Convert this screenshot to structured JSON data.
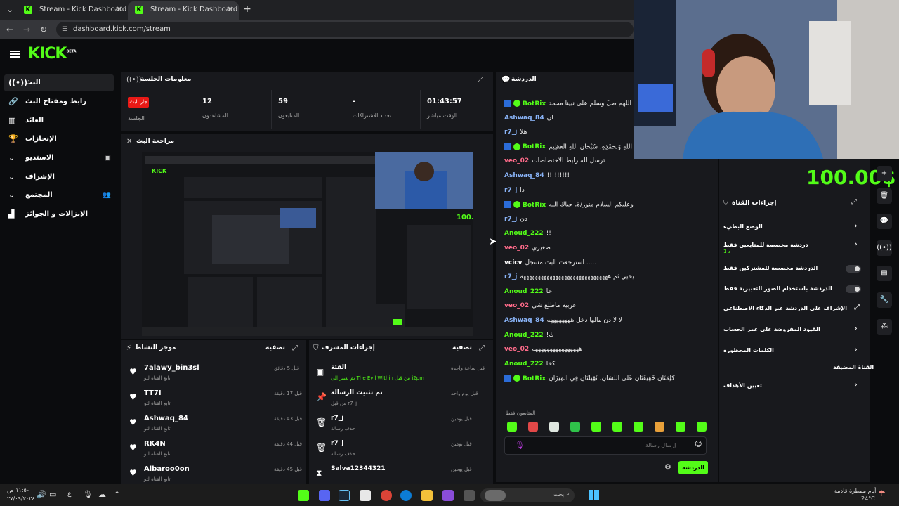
{
  "browser": {
    "tabs": [
      {
        "title": "Stream - Kick Dashboard"
      },
      {
        "title": "Stream - Kick Dashboard"
      }
    ],
    "url": "dashboard.kick.com/stream"
  },
  "app": {
    "logo": "KICK",
    "logo_sup": "BETA"
  },
  "sidebar": {
    "items": [
      {
        "label": "البث",
        "icon": "live-icon"
      },
      {
        "label": "رابط ومفتاح البث",
        "icon": "link-icon"
      },
      {
        "label": "العائد",
        "icon": "library-icon"
      },
      {
        "label": "الإنجازات",
        "icon": "trophy-icon"
      },
      {
        "label": "الاستديو",
        "icon": "chevron-down-icon"
      },
      {
        "label": "الإشراف",
        "icon": "chevron-down-icon"
      },
      {
        "label": "المجتمع",
        "icon": "chevron-down-icon"
      },
      {
        "label": "الإنزالات و الجوائز",
        "icon": "gift-icon"
      }
    ]
  },
  "session": {
    "title": "معلومات الجلسة",
    "live_badge": "جار البث",
    "session_label": "الجلسة",
    "stats": [
      {
        "value": "12",
        "label": "المشاهدون"
      },
      {
        "value": "59",
        "label": "المتابعون"
      },
      {
        "value": "-",
        "label": "تعداد الاشتراكات"
      },
      {
        "value": "01:43:57",
        "label": "الوقت مباشر"
      }
    ]
  },
  "preview": {
    "title": "مراجعة البث"
  },
  "activity_left": {
    "title": "موجز النشاط",
    "filter": "تصفية",
    "items": [
      {
        "name": "7alawy_bin3sl",
        "sub": "تابع القناة لتو",
        "time": "قبل 5 دقائق"
      },
      {
        "name": "TT7I",
        "sub": "تابع القناة لتو",
        "time": "قبل 17 دقيقة"
      },
      {
        "name": "Ashwaq_84",
        "sub": "تابع القناة لتو",
        "time": "قبل 43 دقيقة"
      },
      {
        "name": "RK4N",
        "sub": "تابع القناة لتو",
        "time": "قبل 44 دقيقة"
      },
      {
        "name": "Albaroo0on",
        "sub": "تابع القناة لتو",
        "time": "قبل 45 دقيقة"
      }
    ]
  },
  "activity_mid": {
    "title": "إجراءات المشرف",
    "filter": "تصفية",
    "items": [
      {
        "name": "الفئة",
        "sub": "تم تغيير الى The Evil Within من قبل i2pm",
        "time": "قبل ساعة واحدة"
      },
      {
        "name": "تم تثبيت الرسالة",
        "sub": "من قبل r7_j",
        "time": "قبل يوم واحد"
      },
      {
        "name": "r7_j",
        "sub": "حذف رسالة",
        "time": "قبل يومين"
      },
      {
        "name": "r7_j",
        "sub": "حذف رسالة",
        "time": "قبل يومين"
      },
      {
        "name": "Salva12344321",
        "sub": "",
        "time": "قبل يومين"
      }
    ]
  },
  "chat": {
    "title": "الدردشة",
    "messages": [
      {
        "user": "BotRix",
        "color": "#53fc18",
        "text": "اللهم صلِّ وسلم على نبينا محمد"
      },
      {
        "user": "Ashwaq_84",
        "color": "#8ab4f8",
        "text": "ان"
      },
      {
        "user": "r7_j",
        "color": "#8ab4f8",
        "text": "هلا"
      },
      {
        "user": "BotRix",
        "color": "#53fc18",
        "text": "سُبْحَانَ اللَّهِ وَبِحَمْدِهِ، سُبْحَانَ اللَّهِ الْعَظِيمِ"
      },
      {
        "user": "veo_02",
        "color": "#ff6b8a",
        "text": "ترسل لله رابط الاختصاصات"
      },
      {
        "user": "Ashwaq_84",
        "color": "#8ab4f8",
        "text": "!!!!!!!!!"
      },
      {
        "user": "r7_j",
        "color": "#8ab4f8",
        "text": "دا"
      },
      {
        "user": "BotRix",
        "color": "#53fc18",
        "text": "وعليكم السلام منور/ة، حياك الله"
      },
      {
        "user": "r7_j",
        "color": "#8ab4f8",
        "text": "دن"
      },
      {
        "user": "Anoud_222",
        "color": "#53fc18",
        "text": "!!"
      },
      {
        "user": "veo_02",
        "color": "#ff6b8a",
        "text": "صغيري"
      },
      {
        "user": "vcicv",
        "color": "#ffffff",
        "text": "استرجعت البث مسجل ....."
      },
      {
        "user": "r7_j",
        "color": "#8ab4f8",
        "text": "يحيي ثم ههههههههههههههههههههههههههههههه"
      },
      {
        "user": "Anoud_222",
        "color": "#53fc18",
        "text": "حا"
      },
      {
        "user": "veo_02",
        "color": "#ff6b8a",
        "text": "عربيه ماطلع شي"
      },
      {
        "user": "Ashwaq_84",
        "color": "#8ab4f8",
        "text": "لا لا دن مالها دخل ههههههههه"
      },
      {
        "user": "Anoud_222",
        "color": "#53fc18",
        "text": "!ك"
      },
      {
        "user": "veo_02",
        "color": "#ff6b8a",
        "text": "ههههههههههههههههه"
      },
      {
        "user": "Anoud_222",
        "color": "#53fc18",
        "text": "كخا"
      },
      {
        "user": "BotRix",
        "color": "#53fc18",
        "text": "كَلِمَتَانِ خَفِيفَتَانِ عَلَى اللِّسَانِ، ثَقِيلَتَانِ فِي الْمِيزَانِ"
      }
    ],
    "followers_only": "المتابعون فقط",
    "input_placeholder": "إرسال رسالة",
    "send_button": "الدردشة"
  },
  "channel_actions": {
    "title": "إجراءات القناة",
    "overlay_amount": "100.00$",
    "items": [
      {
        "label": "الوضع البطيء",
        "control": "chevron"
      },
      {
        "label": "دردشة مخصصة للمتابعين فقط",
        "sub": "1 د",
        "control": "chevron"
      },
      {
        "label": "الدردشة مخصصة للمشتركين فقط",
        "control": "toggle"
      },
      {
        "label": "الدردشة باستخدام الصور التعبيرية فقط",
        "control": "toggle"
      },
      {
        "label": "الإشراف على الدردشة عبر الذكاء الاصطناعي",
        "control": "external"
      },
      {
        "label": "القيود المفروضة على عمر الحساب",
        "control": "chevron"
      },
      {
        "label": "الكلمات المحظورة",
        "control": "chevron"
      },
      {
        "label": "القناة المضيفة",
        "control": "none"
      },
      {
        "label": "تعيين الأهداف",
        "control": "chevron"
      }
    ]
  },
  "taskbar": {
    "search": "بحث",
    "weather": "أيام ممطرة قادمة",
    "temp": "24°C",
    "time": "١١:٥٠ ص",
    "date": "٢٧/٠٩/٢٠٢٤"
  },
  "colors": {
    "accent": "#53fc18",
    "live": "#e91916",
    "panel": "#18191d"
  }
}
